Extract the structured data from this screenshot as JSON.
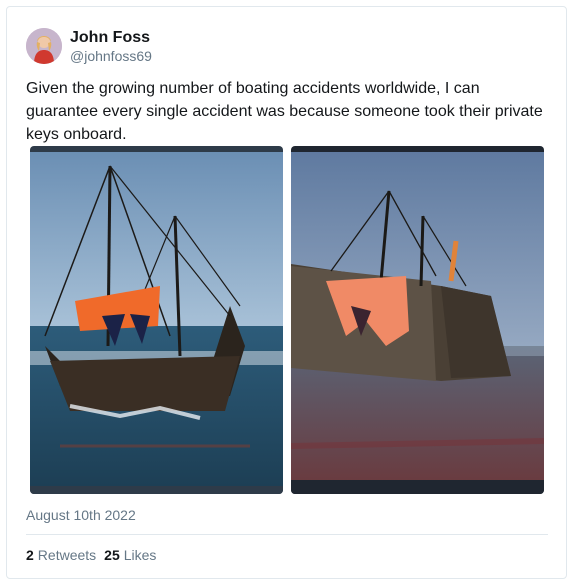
{
  "author": {
    "display_name": "John Foss",
    "handle": "@johnfoss69"
  },
  "tweet": {
    "text": "Given the growing number of boating accidents worldwide, I can guarantee every single accident was because someone took their private keys onboard.",
    "date": "August 10th 2022"
  },
  "media": {
    "images": [
      {
        "icon": "shipwreck-photo-left"
      },
      {
        "icon": "shipwreck-photo-right"
      }
    ]
  },
  "stats": {
    "retweets_count": "2",
    "retweets_label": "Retweets",
    "likes_count": "25",
    "likes_label": "Likes"
  },
  "colors": {
    "text_primary": "#14171a",
    "text_secondary": "#657786",
    "border": "#e1e8ed"
  }
}
